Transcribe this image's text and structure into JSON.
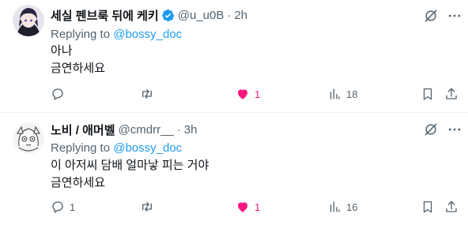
{
  "tweets": [
    {
      "display_name": "세실 펜브룩 뒤에 케키",
      "handle": "@u_u0B",
      "time": "2h",
      "replying_prefix": "Replying to ",
      "replying_to": "@bossy_doc",
      "text_lines": [
        "아나",
        "금연하세요"
      ],
      "replies": "",
      "retweets": "",
      "likes": "1",
      "views": "18",
      "liked": true,
      "verified": true
    },
    {
      "display_name": "노비 / 애머벨",
      "handle": "@cmdrr__",
      "time": "3h",
      "replying_prefix": "Replying to ",
      "replying_to": "@bossy_doc",
      "text_lines": [
        "이 아저씨 담배 얼마낳 피는 거야",
        "금연하세요"
      ],
      "replies": "1",
      "retweets": "",
      "likes": "1",
      "views": "16",
      "liked": true,
      "verified": false
    }
  ],
  "dot": "·",
  "colors": {
    "accent": "#1d9bf0",
    "like": "#f91880",
    "muted": "#536471",
    "text": "#0f1419"
  }
}
